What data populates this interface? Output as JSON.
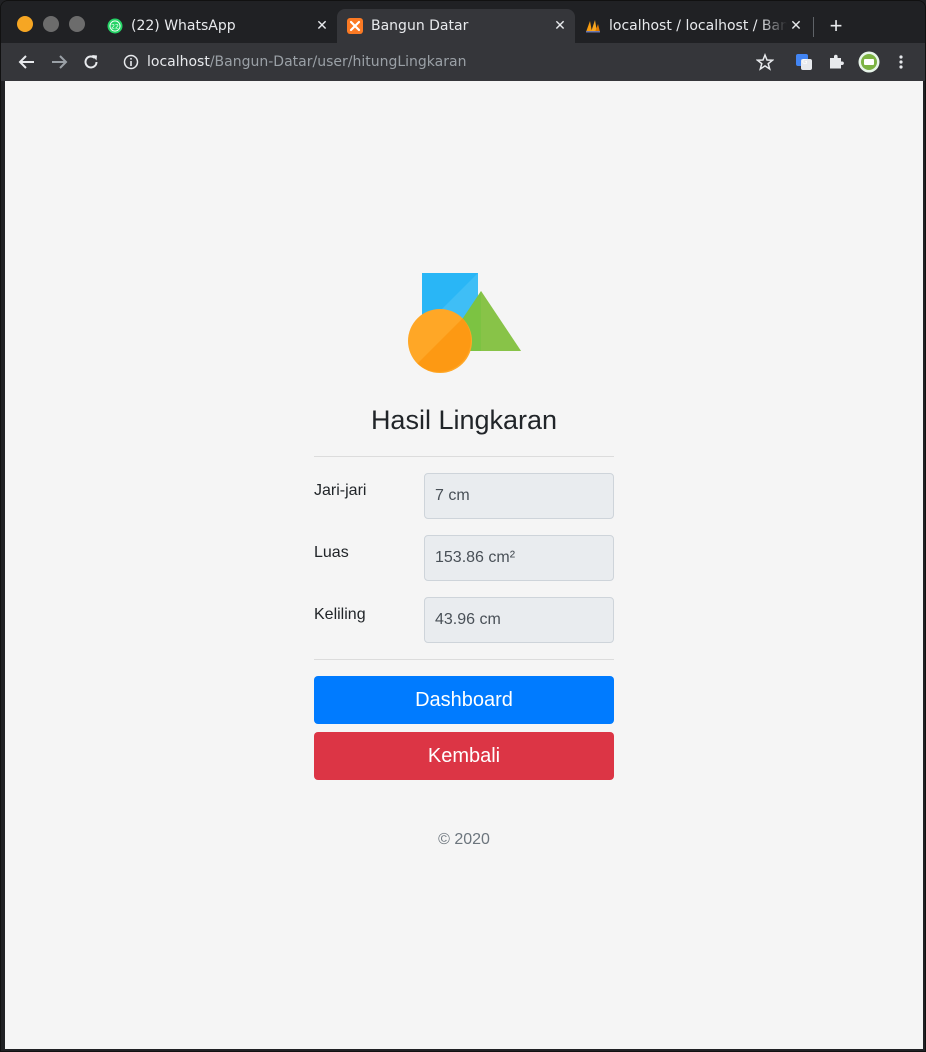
{
  "browser": {
    "tabs": [
      {
        "label": "(22) WhatsApp",
        "badge": "22"
      },
      {
        "label": "Bangun Datar"
      },
      {
        "label": "localhost / localhost / Bangun"
      }
    ],
    "url": {
      "host": "localhost",
      "path": "/Bangun-Datar/user/hitungLingkaran"
    }
  },
  "page": {
    "title": "Hasil Lingkaran",
    "rows": [
      {
        "label": "Jari-jari",
        "value": "7 cm"
      },
      {
        "label": "Luas",
        "value": "153.86 cm²"
      },
      {
        "label": "Keliling",
        "value": "43.96 cm"
      }
    ],
    "buttons": {
      "dashboard": "Dashboard",
      "back": "Kembali"
    },
    "footer": "© 2020"
  },
  "colors": {
    "primary": "#007bff",
    "danger": "#dc3545",
    "logo_square": "#29b6f6",
    "logo_triangle": "#7cc342",
    "logo_circle": "#ffa726"
  }
}
